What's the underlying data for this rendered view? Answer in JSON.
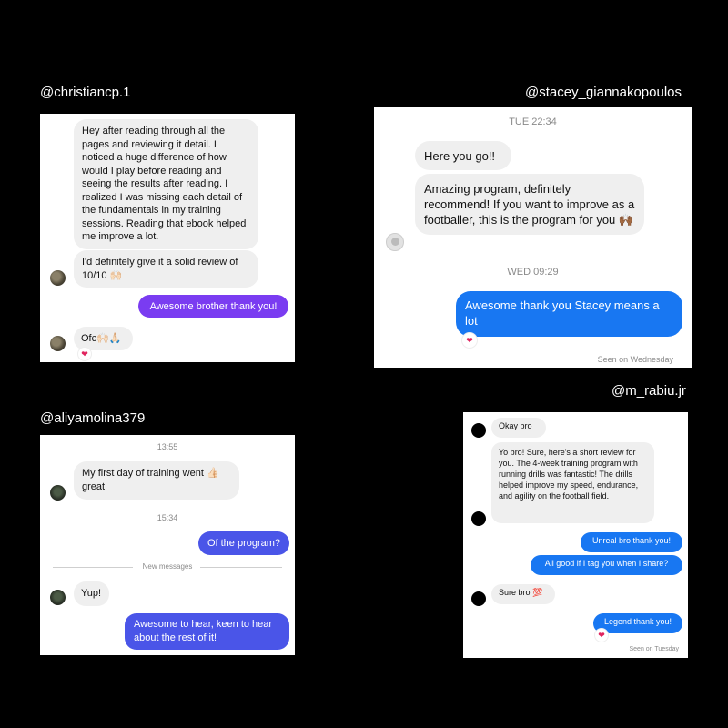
{
  "handles": {
    "christian": "@christiancp.1",
    "stacey": "@stacey_giannakopoulos",
    "aliya": "@aliyamolina379",
    "rabiu": "@m_rabiu.jr"
  },
  "panel1": {
    "msg1": "Hey after reading through all the pages and reviewing it detail. I noticed a huge difference of how would I play before reading and seeing the results after reading. I realized I was missing each detail of the fundamentals in my training sessions. Reading that ebook helped me improve a lot.",
    "msg2": "I'd definitely give it a solid review of 10/10 🙌🏻",
    "reply": "Awesome brother thank you!",
    "msg3": "Ofc🙌🏻🙏🏻",
    "reaction": "❤"
  },
  "panel2": {
    "time1": "TUE 22:34",
    "msg1": "Here you go!!",
    "msg2": "Amazing program, definitely recommend! If you want to improve as a footballer, this is the program for you 🙌🏾",
    "time2": "WED 09:29",
    "reply": "Awesome thank you Stacey means a lot",
    "reaction": "❤",
    "seen": "Seen on Wednesday"
  },
  "panel3": {
    "time1": "13:55",
    "msg1": "My first day of training went 👍🏻 great",
    "time2": "15:34",
    "reply1": "Of the program?",
    "divider": "New messages",
    "msg2": "Yup!",
    "reply2": "Awesome to hear, keen to hear about the rest of it!"
  },
  "panel4": {
    "msg1": "Okay bro",
    "msg2": "Yo bro! Sure, here's a short review for you. The 4-week training program with running drills was fantastic! The drills helped improve my speed, endurance, and agility on the football field.",
    "reply1": "Unreal bro thank you!",
    "reply2": "All good if I tag you when I share?",
    "msg3": "Sure bro 💯",
    "reply3": "Legend thank you!",
    "reaction": "❤",
    "seen": "Seen on Tuesday"
  },
  "colors": {
    "background": "#000000",
    "purple_bubble": "#7a3cf1",
    "blue_bubble": "#1877f2",
    "indigo_bubble": "#4a55e8",
    "incoming_bubble": "#efefef"
  }
}
